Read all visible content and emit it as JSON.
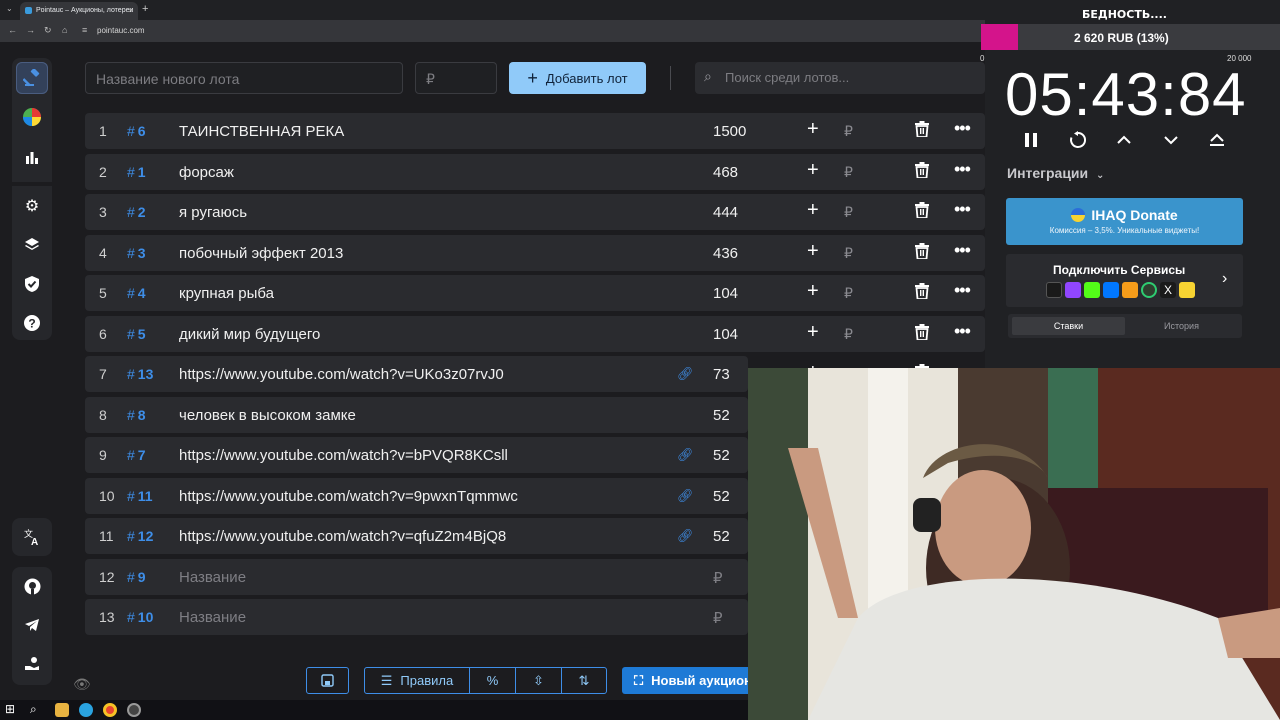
{
  "browser": {
    "tab_title": "Pointauc – Аукционы, лотереи",
    "url": "pointauc.com"
  },
  "lot_form": {
    "name_placeholder": "Название нового лота",
    "amount_placeholder": "₽",
    "add_label": "Добавить лот",
    "search_placeholder": "Поиск среди лотов..."
  },
  "lots": [
    {
      "pos": "1",
      "id": "6",
      "name": "ТАИНСТВЕННАЯ РЕКА",
      "amount": "1500",
      "link": false
    },
    {
      "pos": "2",
      "id": "1",
      "name": "форсаж",
      "amount": "468",
      "link": false
    },
    {
      "pos": "3",
      "id": "2",
      "name": "я ругаюсь",
      "amount": "444",
      "link": false
    },
    {
      "pos": "4",
      "id": "3",
      "name": "побочный эффект 2013",
      "amount": "436",
      "link": false
    },
    {
      "pos": "5",
      "id": "4",
      "name": "крупная рыба",
      "amount": "104",
      "link": false
    },
    {
      "pos": "6",
      "id": "5",
      "name": "дикий мир будущего",
      "amount": "104",
      "link": false
    },
    {
      "pos": "7",
      "id": "13",
      "name": "https://www.youtube.com/watch?v=UKo3z07rvJ0",
      "amount": "73",
      "link": true
    },
    {
      "pos": "8",
      "id": "8",
      "name": "человек в высоком замке",
      "amount": "52",
      "link": false
    },
    {
      "pos": "9",
      "id": "7",
      "name": "https://www.youtube.com/watch?v=bPVQR8KCsll",
      "amount": "52",
      "link": true
    },
    {
      "pos": "10",
      "id": "11",
      "name": "https://www.youtube.com/watch?v=9pwxnTqmmwc",
      "amount": "52",
      "link": true
    },
    {
      "pos": "11",
      "id": "12",
      "name": "https://www.youtube.com/watch?v=qfuZ2m4BjQ8",
      "amount": "52",
      "link": true
    },
    {
      "pos": "12",
      "id": "9",
      "name": "Название",
      "amount": "₽",
      "link": false,
      "placeholder": true
    },
    {
      "pos": "13",
      "id": "10",
      "name": "Название",
      "amount": "₽",
      "link": false,
      "placeholder": true
    }
  ],
  "toolbar": {
    "rules_label": "Правила",
    "new_auction_label": "Новый аукцион"
  },
  "goal": {
    "title": "БЕДНОСТЬ....",
    "progress_label": "2 620 RUB (13%)",
    "progress": 0.13,
    "min_label": "0",
    "max_label": "20 000",
    "fill_color": "#d4148b"
  },
  "timer": {
    "value": "05:43:84"
  },
  "integrations": {
    "label": "Интеграции",
    "donate_title": "IHAQ Donate",
    "donate_subtitle": "Комиссия – 3,5%. Уникальные виджеты!",
    "services_title": "Подключить Сервисы",
    "tab_bids": "Ставки",
    "tab_history": "История"
  },
  "colors": {
    "accent": "#3e8ee8",
    "add_button": "#90caf9",
    "donate_bg": "#3a94cc"
  }
}
